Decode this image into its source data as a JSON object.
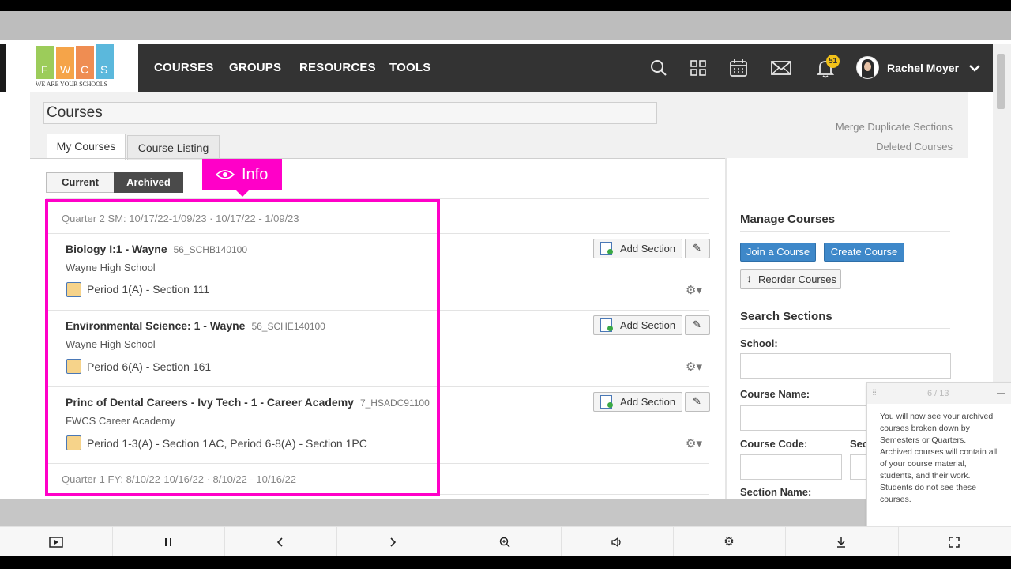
{
  "logo": {
    "letters": [
      "F",
      "W",
      "C",
      "S"
    ],
    "tagline": "WE ARE YOUR SCHOOLS"
  },
  "nav": {
    "links": [
      "COURSES",
      "GROUPS",
      "RESOURCES",
      "TOOLS"
    ],
    "notification_count": "51",
    "user_name": "Rachel Moyer",
    "icons": [
      "search-icon",
      "apps-grid-icon",
      "calendar-icon",
      "mail-icon",
      "bell-icon",
      "chevron-down-icon"
    ]
  },
  "page": {
    "title": "Courses",
    "tabs": [
      "My Courses",
      "Course Listing"
    ],
    "links": [
      "Merge Duplicate Sections",
      "Deleted Courses"
    ],
    "segment": [
      "Current",
      "Archived"
    ]
  },
  "annotation": {
    "label": "Info",
    "color": "#ff00c8"
  },
  "quarters": [
    "Quarter 2 SM: 10/17/22-1/09/23 · 10/17/22 - 1/09/23",
    "Quarter 1 FY: 8/10/22-10/16/22 · 8/10/22 - 10/16/22"
  ],
  "courses": [
    {
      "title": "Biology I:1 - Wayne",
      "code": "56_SCHB140100",
      "school": "Wayne High School",
      "period": "Period 1(A) - Section 111"
    },
    {
      "title": "Environmental Science: 1 - Wayne",
      "code": "56_SCHE140100",
      "school": "Wayne High School",
      "period": "Period 6(A) - Section 161"
    },
    {
      "title": "Princ of Dental Careers - Ivy Tech - 1 - Career Academy",
      "code": "7_HSADC91100",
      "school": "FWCS Career Academy",
      "period": "Period 1-3(A) - Section 1AC, Period 6-8(A) - Section 1PC"
    }
  ],
  "buttons": {
    "add_section": "Add Section"
  },
  "sidebar": {
    "manage_heading": "Manage Courses",
    "join": "Join a Course",
    "create": "Create Course",
    "reorder": "Reorder Courses",
    "search_heading": "Search Sections",
    "labels": {
      "school": "School:",
      "course_name": "Course Name:",
      "course_code": "Course Code:",
      "section_partial": "Sect",
      "section_name": "Section Name:"
    }
  },
  "tip": {
    "progress": "6 / 13",
    "text": "You will now see your archived courses broken down by Semesters or Quarters. Archived courses will contain all of your course material, students, and their work. Students do not see these courses."
  },
  "player": {
    "controls": [
      "screen-icon",
      "pause-icon",
      "prev-icon",
      "next-icon",
      "zoom-icon",
      "volume-icon",
      "settings-icon",
      "download-icon",
      "fullscreen-icon"
    ]
  },
  "colors": {
    "nav_bg": "#333333",
    "highlight": "#ff00c8",
    "primary_button": "#3e88c9"
  }
}
